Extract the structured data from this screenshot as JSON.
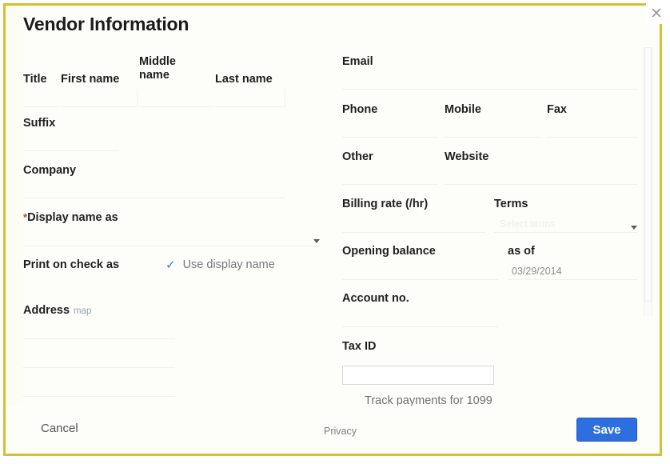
{
  "dialog": {
    "title": "Vendor Information",
    "close_icon": "close-x-icon",
    "border_color": "#d8bf31",
    "accent_color": "#2d6ee0",
    "required_marker": "*"
  },
  "name_row": {
    "title_label": "Title",
    "first_name_label": "First name",
    "middle_name_label": "Middle name",
    "last_name_label": "Last name"
  },
  "left_column": {
    "suffix_label": "Suffix",
    "company_label": "Company",
    "display_name_label": "Display name as",
    "display_name_caret_icon": "chevron-down-icon",
    "print_on_check_label": "Print on check as",
    "use_display_name_label": "Use display name",
    "use_display_name_checked": true,
    "use_display_name_check_icon": "checkmark-icon",
    "address_label": "Address",
    "address_map_link": "map"
  },
  "right_column": {
    "email_label": "Email",
    "phone_label": "Phone",
    "mobile_label": "Mobile",
    "fax_label": "Fax",
    "other_label": "Other",
    "website_label": "Website",
    "billing_rate_label": "Billing rate (/hr)",
    "terms_label": "Terms",
    "terms_caret_icon": "chevron-down-icon",
    "terms_placeholder": "Select terms",
    "opening_balance_label": "Opening balance",
    "as_of_label": "as of",
    "as_of_date": "03/29/2014",
    "account_no_label": "Account no.",
    "tax_id_label": "Tax ID",
    "tax_id_value": "",
    "tax_id_placeholder": "",
    "track_1099_label": "Track payments for 1099"
  },
  "footer": {
    "cancel_label": "Cancel",
    "privacy_label": "Privacy",
    "save_label": "Save",
    "watermark_text": ""
  },
  "scrollbar": {
    "orientation": "vertical",
    "thumb_position_percent": 0
  }
}
